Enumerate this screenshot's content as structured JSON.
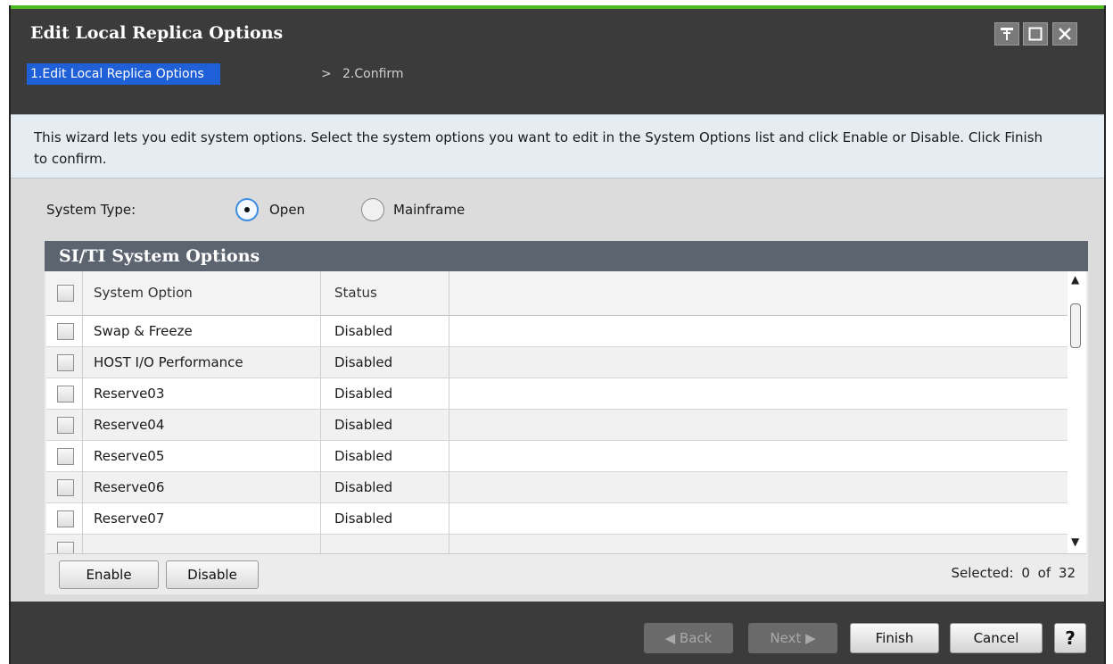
{
  "window": {
    "title": "Edit Local Replica Options"
  },
  "wizard": {
    "steps": [
      {
        "label": "1.Edit Local Replica Options"
      },
      {
        "label": "2.Confirm"
      }
    ],
    "separator": ">"
  },
  "description": "This wizard lets you edit system options. Select the system options you want to edit in the System Options list and click Enable or Disable. Click Finish to confirm.",
  "system_type": {
    "label": "System Type:",
    "options": [
      "Open",
      "Mainframe"
    ],
    "selected": "Open"
  },
  "panel": {
    "title": "SI/TI System Options",
    "columns": [
      "System Option",
      "Status"
    ],
    "rows": [
      {
        "option": "Swap & Freeze",
        "status": "Disabled"
      },
      {
        "option": "HOST I/O Performance",
        "status": "Disabled"
      },
      {
        "option": "Reserve03",
        "status": "Disabled"
      },
      {
        "option": "Reserve04",
        "status": "Disabled"
      },
      {
        "option": "Reserve05",
        "status": "Disabled"
      },
      {
        "option": "Reserve06",
        "status": "Disabled"
      },
      {
        "option": "Reserve07",
        "status": "Disabled"
      }
    ],
    "enable_label": "Enable",
    "disable_label": "Disable",
    "selected_text": "Selected:  0   of  32"
  },
  "footer": {
    "back": "◀ Back",
    "next": "Next ▶",
    "finish": "Finish",
    "cancel": "Cancel",
    "help": "?"
  },
  "colors": {
    "accent": "#4dba1f",
    "active_step": "#1f5fd8",
    "titlebar": "#3b3b3b"
  }
}
